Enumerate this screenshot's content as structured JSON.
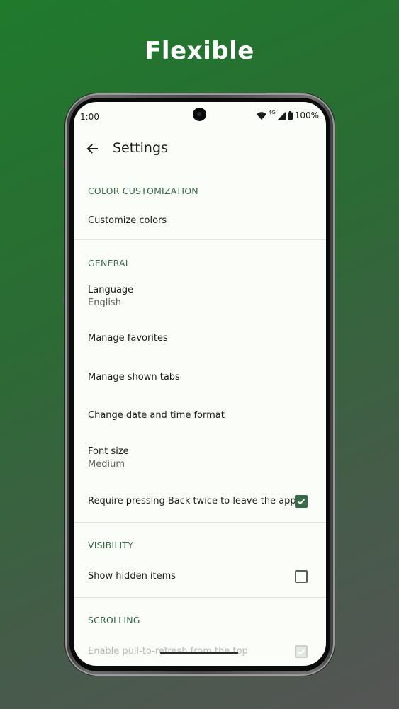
{
  "promo": {
    "headline": "Flexible"
  },
  "status_bar": {
    "time": "1:00",
    "network": "4G",
    "battery": "100%"
  },
  "app_bar": {
    "title": "Settings",
    "back_icon": "arrow-left-icon"
  },
  "sections": {
    "color": {
      "header": "COLOR CUSTOMIZATION",
      "customize_colors": "Customize colors"
    },
    "general": {
      "header": "GENERAL",
      "language_label": "Language",
      "language_value": "English",
      "manage_favorites": "Manage favorites",
      "manage_tabs": "Manage shown tabs",
      "date_format": "Change date and time format",
      "font_size_label": "Font size",
      "font_size_value": "Medium",
      "back_twice_label": "Require pressing Back twice to leave the app",
      "back_twice_checked": true
    },
    "visibility": {
      "header": "VISIBILITY",
      "show_hidden_label": "Show hidden items",
      "show_hidden_checked": false
    },
    "scrolling": {
      "header": "SCROLLING",
      "pull_refresh_label": "Enable pull-to-refresh from the top",
      "pull_refresh_checked": true
    }
  },
  "colors": {
    "accent": "#386a47",
    "surface": "#fbfdf8",
    "on_surface": "#1a1c19"
  }
}
